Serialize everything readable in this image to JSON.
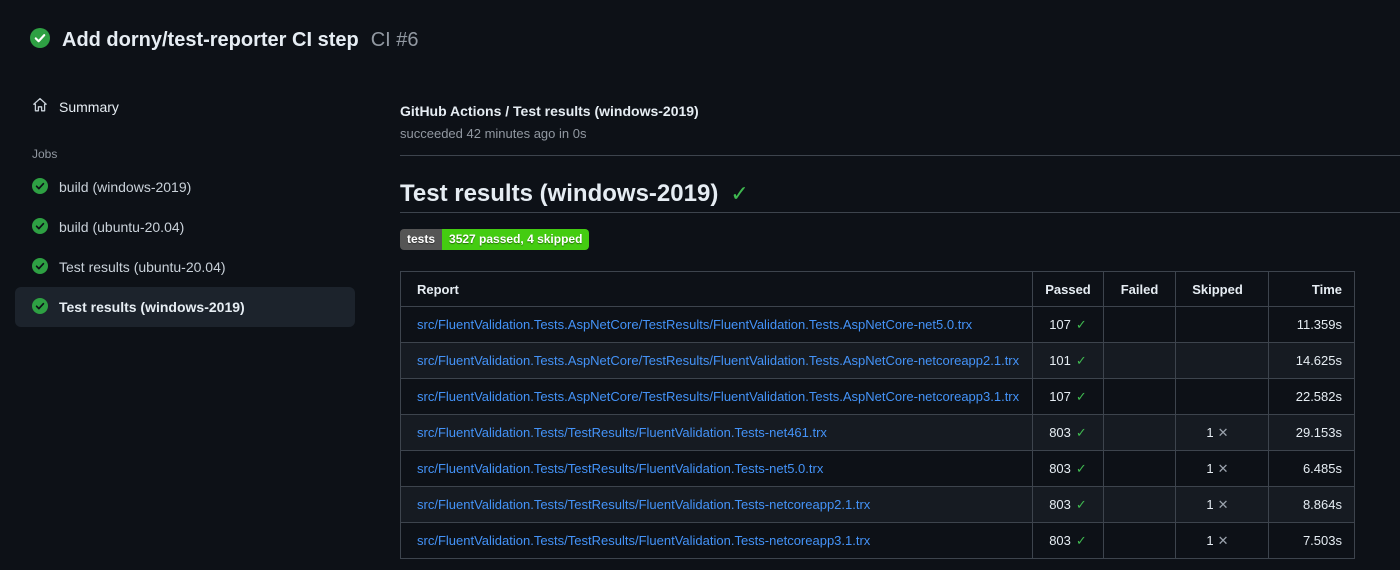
{
  "run_header": {
    "title": "Add dorny/test-reporter CI step",
    "run_number": "CI #6"
  },
  "sidebar": {
    "summary_label": "Summary",
    "jobs_section_label": "Jobs",
    "jobs": [
      {
        "label": "build (windows-2019)",
        "status": "success",
        "active": false
      },
      {
        "label": "build (ubuntu-20.04)",
        "status": "success",
        "active": false
      },
      {
        "label": "Test results (ubuntu-20.04)",
        "status": "success",
        "active": false
      },
      {
        "label": "Test results (windows-2019)",
        "status": "success",
        "active": true
      }
    ]
  },
  "main": {
    "breadcrumb": "GitHub Actions / Test results (windows-2019)",
    "status_line": "succeeded 42 minutes ago in 0s",
    "heading": "Test results (windows-2019)",
    "heading_check": "✓",
    "badge": {
      "label": "tests",
      "value": "3527 passed, 4 skipped",
      "label_bg": "#555555",
      "value_bg": "#44cc11"
    },
    "table": {
      "headers": [
        "Report",
        "Passed",
        "Failed",
        "Skipped",
        "Time"
      ],
      "pass_icon": "✓",
      "skip_icon": "✕",
      "rows": [
        {
          "report": "src/FluentValidation.Tests.AspNetCore/TestResults/FluentValidation.Tests.AspNetCore-net5.0.trx",
          "passed": "107",
          "failed": "",
          "skipped": "",
          "time": "11.359s"
        },
        {
          "report": "src/FluentValidation.Tests.AspNetCore/TestResults/FluentValidation.Tests.AspNetCore-netcoreapp2.1.trx",
          "passed": "101",
          "failed": "",
          "skipped": "",
          "time": "14.625s"
        },
        {
          "report": "src/FluentValidation.Tests.AspNetCore/TestResults/FluentValidation.Tests.AspNetCore-netcoreapp3.1.trx",
          "passed": "107",
          "failed": "",
          "skipped": "",
          "time": "22.582s"
        },
        {
          "report": "src/FluentValidation.Tests/TestResults/FluentValidation.Tests-net461.trx",
          "passed": "803",
          "failed": "",
          "skipped": "1",
          "time": "29.153s"
        },
        {
          "report": "src/FluentValidation.Tests/TestResults/FluentValidation.Tests-net5.0.trx",
          "passed": "803",
          "failed": "",
          "skipped": "1",
          "time": "6.485s"
        },
        {
          "report": "src/FluentValidation.Tests/TestResults/FluentValidation.Tests-netcoreapp2.1.trx",
          "passed": "803",
          "failed": "",
          "skipped": "1",
          "time": "8.864s"
        },
        {
          "report": "src/FluentValidation.Tests/TestResults/FluentValidation.Tests-netcoreapp3.1.trx",
          "passed": "803",
          "failed": "",
          "skipped": "1",
          "time": "7.503s"
        }
      ]
    }
  },
  "colors": {
    "page_bg": "#0d1117",
    "row_alt_bg": "#161b22",
    "border": "#3d444d",
    "link_blue": "#4493f8",
    "success_green": "#2ea043",
    "check_green": "#3fb950",
    "muted_text": "#9198a1"
  }
}
